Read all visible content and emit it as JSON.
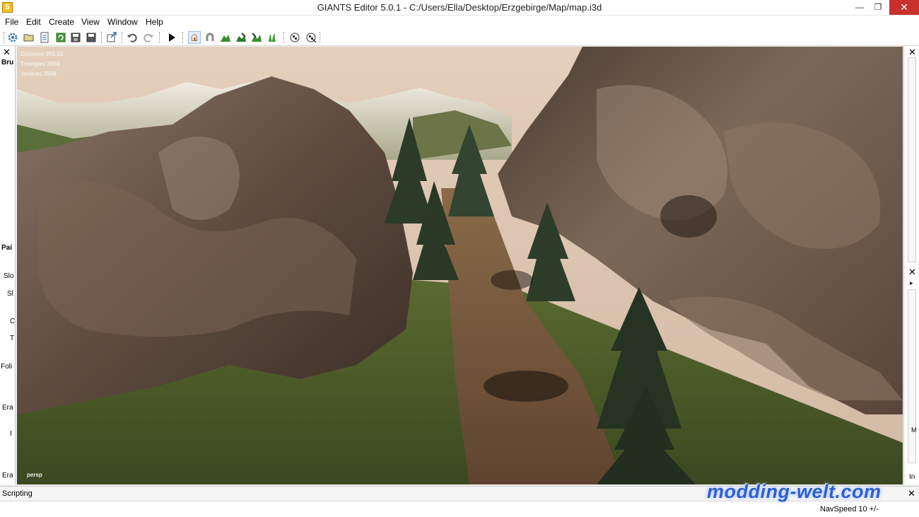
{
  "window": {
    "title": "GIANTS Editor 5.0.1 - C:/Users/Ella/Desktop/Erzgebirge/Map/map.i3d",
    "icon_label": "S",
    "minimize_icon": "minimize-icon",
    "maximize_icon": "restore-icon",
    "close_icon": "close-icon"
  },
  "menu": {
    "items": [
      "File",
      "Edit",
      "Create",
      "View",
      "Window",
      "Help"
    ]
  },
  "toolbar": {
    "icons": [
      "settings-icon",
      "open-icon",
      "save-list-icon",
      "refresh-icon",
      "save-icon",
      "save-all-icon",
      "export-icon",
      "undo-icon",
      "redo-icon",
      "play-icon",
      "select-icon",
      "magnet-icon",
      "terrain-sculpt-icon",
      "terrain-paint-icon",
      "foliage-paint-icon",
      "grass-paint-icon",
      "checker-icon",
      "checker-cursor-icon"
    ]
  },
  "left_panel": {
    "labels": [
      "Bru",
      "Pai",
      "Slo",
      "Sl",
      "C",
      "T",
      "Foli",
      "Era",
      "I",
      "Era"
    ]
  },
  "viewport": {
    "stats": {
      "distance": "Distance 355.33",
      "triangles": "Triangles 3059",
      "vertices": "Vertices 3558"
    },
    "camera_label": "persp",
    "colors": {
      "sky": "#d8c2ae",
      "rock": "#6e5a4c",
      "grass": "#4a5a28",
      "path": "#7a5a3c",
      "tree": "#2c3a28"
    }
  },
  "right_panel": {
    "labels": [
      "M",
      "In"
    ],
    "arrow_icon": "chevron-right-icon"
  },
  "bottom": {
    "scripting_label": "Scripting",
    "navspeed": "NavSpeed 10 +/-",
    "watermark": "modding-welt.com"
  }
}
